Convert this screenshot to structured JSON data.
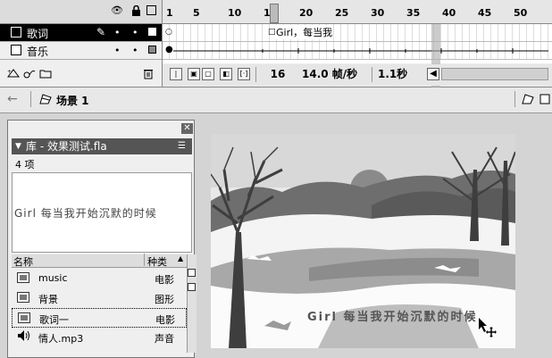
{
  "timeline": {
    "header_icons": [
      "eye-icon",
      "lock-icon",
      "outline-icon"
    ],
    "ruler_ticks": [
      "1",
      "5",
      "10",
      "15",
      "20",
      "25",
      "30",
      "35",
      "40",
      "45",
      "50"
    ],
    "layers": [
      {
        "name": "歌词",
        "selected": true
      },
      {
        "name": "音乐",
        "selected": false
      }
    ],
    "frame_label": "Girl，每当我",
    "current_frame": "16",
    "frame_rate": "14.0 帧/秒",
    "elapsed": "1.1秒"
  },
  "scene": {
    "name": "场景 1"
  },
  "library": {
    "title": "库 - 效果测试.fla",
    "count": "4 项",
    "preview_text": "Girl 每当我开始沉默的时候",
    "col_name": "名称",
    "col_kind": "种类",
    "items": [
      {
        "name": "music",
        "kind": "电影",
        "icon": "movieclip-icon",
        "selected": false
      },
      {
        "name": "背景",
        "kind": "图形",
        "icon": "graphic-icon",
        "selected": false
      },
      {
        "name": "歌词一",
        "kind": "电影",
        "icon": "movieclip-icon",
        "selected": true
      },
      {
        "name": "情人.mp3",
        "kind": "声音",
        "icon": "sound-icon",
        "selected": false
      }
    ]
  },
  "stage": {
    "text": "Girl 每当我开始沉默的时候"
  }
}
